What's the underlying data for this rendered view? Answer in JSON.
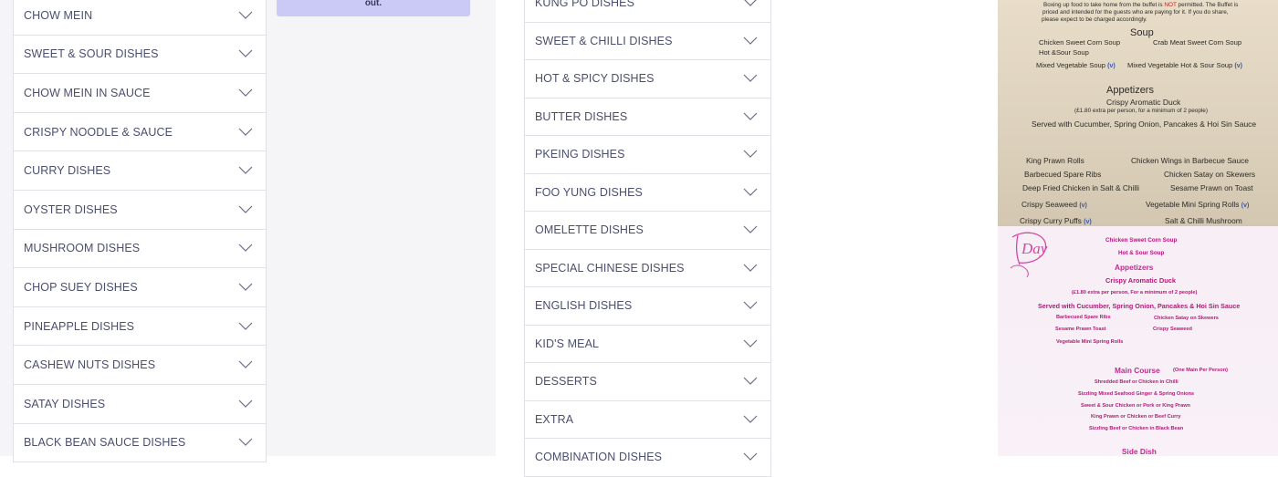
{
  "notice": {
    "text": "out."
  },
  "menu_left": {
    "items": [
      "CHOW MEIN",
      "SWEET & SOUR DISHES",
      "CHOW MEIN IN SAUCE",
      "CRISPY NOODLE & SAUCE",
      "CURRY DISHES",
      "OYSTER DISHES",
      "MUSHROOM DISHES",
      "CHOP SUEY DISHES",
      "PINEAPPLE DISHES",
      "CASHEW NUTS DISHES",
      "SATAY DISHES",
      "BLACK BEAN SAUCE DISHES"
    ]
  },
  "menu_mid": {
    "items": [
      "KUNG PO DISHES",
      "SWEET & CHILLI DISHES",
      "HOT & SPICY DISHES",
      "BUTTER DISHES",
      "PKEING DISHES",
      "FOO YUNG DISHES",
      "OMELETTE DISHES",
      "SPECIAL CHINESE DISHES",
      "ENGLISH DISHES",
      "KID'S MEAL",
      "DESSERTS",
      "EXTRA",
      "COMBINATION DISHES"
    ]
  },
  "photo1": {
    "intro_1a": "Boxing up food to take home from the buffet is ",
    "intro_not": "NOT",
    "intro_1b": " permitted. The Buffet is",
    "intro_2": "priced and intended for the guests who are paying for it. If you do share,",
    "intro_3": "please expect to be charged accordingly.",
    "soup_heading": "Soup",
    "soup_1": "Chicken Sweet Corn Soup",
    "soup_2": "Crab Meat Sweet Corn Soup",
    "soup_3": "Hot &Sour Soup",
    "soup_4": "Mixed Vegetable Soup",
    "soup_5": "Mixed Vegetable Hot & Sour Soup",
    "v": "(v)",
    "appetizers_heading": "Appetizers",
    "duck": "Crispy Aromatic Duck",
    "duck_note": "(£1.80 extra per person, for a minimum of 2 people)",
    "duck_served": "Served with Cucumber, Spring Onion, Pancakes & Hoi Sin Sauce",
    "a1": "King Prawn Rolls",
    "a2": "Chicken Wings in Barbecue Sauce",
    "a3": "Barbecued Spare Ribs",
    "a4": "Chicken Satay on Skewers",
    "a5": "Deep Fried Chicken in Salt & Chilli",
    "a6": "Sesame Prawn on Toast",
    "a7": "Crispy Seaweed",
    "a8": "Vegetable Mini Spring Rolls",
    "a9": "Crispy Curry Puffs",
    "a10": "Salt & Chilli Mushroom"
  },
  "photo2": {
    "logo_text": "Day",
    "soup_1": "Chicken Sweet Corn Soup",
    "soup_2": "Hot & Sour Soup",
    "appetizers_heading": "Appetizers",
    "duck": "Crispy Aromatic Duck",
    "duck_note": "(£1.80 extra per person, For a minimum of 2 people)",
    "duck_served": "Served with Cucumber, Spring Onion, Pancakes & Hoi Sin Sauce",
    "a1": "Barbecued Spare Ribs",
    "a2": "Chicken Satay on Skewers",
    "a3": "Sesame Prawn Toast",
    "a4": "Crispy Seaweed",
    "a5": "Vegetable Mini Spring Rolls",
    "main_heading": "Main Course",
    "main_note": "(One Main Per Person)",
    "m1": "Shredded Beef or Chicken in Chilli",
    "m2": "Sizzling Mixed Seafood Ginger & Spring Onions",
    "m3": "Sweet & Sour Chicken or Pork or King Prawn",
    "m4": "King Prawn or Chicken or Beef Curry",
    "m5": "Sizzling Beef or Chicken in Black Bean",
    "side_heading": "Side Dish"
  },
  "colors": {
    "text": "#4a4f6e",
    "notice": "#cbc9f5",
    "border": "#e1e0e6"
  },
  "icons": {
    "expand": "chevron-down-icon"
  }
}
